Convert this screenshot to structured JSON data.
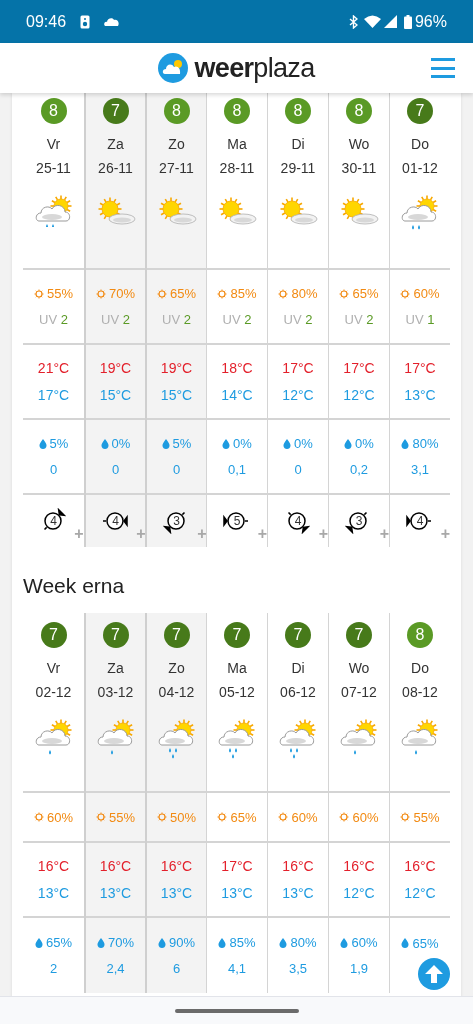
{
  "status_bar": {
    "time": "09:46",
    "battery": "96%"
  },
  "header": {
    "logo_text": {
      "bold": "weer",
      "light": "plaza"
    }
  },
  "weeks": [
    {
      "days": [
        {
          "score": "8",
          "color": "#5a9a25",
          "day": "Vr",
          "date": "25-11",
          "highlighted": false,
          "kind": "cloudy-sun",
          "sun": "55%",
          "uv": {
            "label": "UV",
            "value": "2"
          },
          "max": "21°C",
          "min": "17°C",
          "rain_chance": "5%",
          "rain_amount": "0",
          "wind": {
            "force": "4",
            "kind": "southwest",
            "more": "+"
          }
        },
        {
          "score": "7",
          "color": "#477a1a",
          "day": "Za",
          "date": "26-11",
          "highlighted": true,
          "kind": "sunny",
          "sun": "70%",
          "uv": {
            "label": "UV",
            "value": "2"
          },
          "max": "19°C",
          "min": "15°C",
          "rain_chance": "0%",
          "rain_amount": "0",
          "wind": {
            "force": "4",
            "kind": "west",
            "more": "+"
          }
        },
        {
          "score": "8",
          "color": "#5a9a25",
          "day": "Zo",
          "date": "27-11",
          "highlighted": true,
          "kind": "sunny",
          "sun": "65%",
          "uv": {
            "label": "UV",
            "value": "2"
          },
          "max": "19°C",
          "min": "15°C",
          "rain_chance": "5%",
          "rain_amount": "0",
          "wind": {
            "force": "3",
            "kind": "northeast",
            "more": "+"
          }
        },
        {
          "score": "8",
          "color": "#5a9a25",
          "day": "Ma",
          "date": "28-11",
          "highlighted": false,
          "kind": "sunny",
          "sun": "85%",
          "uv": {
            "label": "UV",
            "value": "2"
          },
          "max": "18°C",
          "min": "14°C",
          "rain_chance": "0%",
          "rain_amount": "0,1",
          "wind": {
            "force": "5",
            "kind": "east",
            "more": "+"
          }
        },
        {
          "score": "8",
          "color": "#5a9a25",
          "day": "Di",
          "date": "29-11",
          "highlighted": false,
          "kind": "sunny",
          "sun": "80%",
          "uv": {
            "label": "UV",
            "value": "2"
          },
          "max": "17°C",
          "min": "12°C",
          "rain_chance": "0%",
          "rain_amount": "0",
          "wind": {
            "force": "4",
            "kind": "northwest",
            "more": "+"
          }
        },
        {
          "score": "8",
          "color": "#5a9a25",
          "day": "Wo",
          "date": "30-11",
          "highlighted": false,
          "kind": "sunny",
          "sun": "65%",
          "uv": {
            "label": "UV",
            "value": "2"
          },
          "max": "17°C",
          "min": "12°C",
          "rain_chance": "0%",
          "rain_amount": "0,2",
          "wind": {
            "force": "3",
            "kind": "northeast",
            "more": "+"
          }
        },
        {
          "score": "7",
          "color": "#477a1a",
          "day": "Do",
          "date": "01-12",
          "highlighted": false,
          "kind": "showers",
          "sun": "60%",
          "uv": {
            "label": "UV",
            "value": "1"
          },
          "max": "17°C",
          "min": "13°C",
          "rain_chance": "80%",
          "rain_amount": "3,1",
          "wind": {
            "force": "4",
            "kind": "east",
            "more": "+"
          }
        }
      ]
    },
    {
      "title": "Week erna",
      "days": [
        {
          "score": "7",
          "color": "#477a1a",
          "day": "Vr",
          "date": "02-12",
          "highlighted": false,
          "kind": "drizzle",
          "sun": "60%",
          "max": "16°C",
          "min": "13°C",
          "rain_chance": "65%",
          "rain_amount": "2"
        },
        {
          "score": "7",
          "color": "#477a1a",
          "day": "Za",
          "date": "03-12",
          "highlighted": true,
          "kind": "drizzle",
          "sun": "55%",
          "max": "16°C",
          "min": "13°C",
          "rain_chance": "70%",
          "rain_amount": "2,4"
        },
        {
          "score": "7",
          "color": "#477a1a",
          "day": "Zo",
          "date": "04-12",
          "highlighted": true,
          "kind": "rain",
          "sun": "50%",
          "max": "16°C",
          "min": "13°C",
          "rain_chance": "90%",
          "rain_amount": "6"
        },
        {
          "score": "7",
          "color": "#477a1a",
          "day": "Ma",
          "date": "05-12",
          "highlighted": false,
          "kind": "rain",
          "sun": "65%",
          "max": "17°C",
          "min": "13°C",
          "rain_chance": "85%",
          "rain_amount": "4,1"
        },
        {
          "score": "7",
          "color": "#477a1a",
          "day": "Di",
          "date": "06-12",
          "highlighted": false,
          "kind": "rain",
          "sun": "60%",
          "max": "16°C",
          "min": "13°C",
          "rain_chance": "80%",
          "rain_amount": "3,5"
        },
        {
          "score": "7",
          "color": "#477a1a",
          "day": "Wo",
          "date": "07-12",
          "highlighted": false,
          "kind": "drizzle",
          "sun": "60%",
          "max": "16°C",
          "min": "12°C",
          "rain_chance": "60%",
          "rain_amount": "1,9"
        },
        {
          "score": "8",
          "color": "#5a9a25",
          "day": "Do",
          "date": "08-12",
          "highlighted": false,
          "kind": "drizzle",
          "sun": "55%",
          "max": "16°C",
          "min": "12°C",
          "rain_chance": "65%"
        }
      ]
    }
  ]
}
